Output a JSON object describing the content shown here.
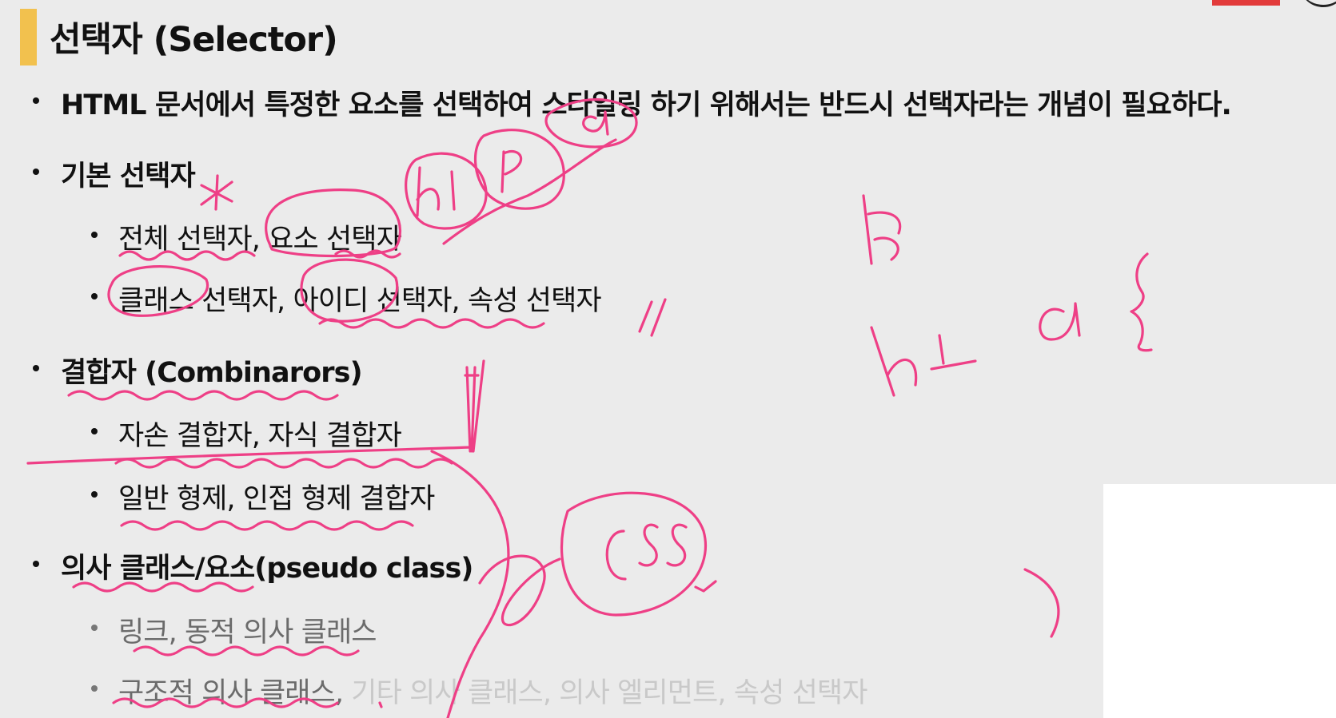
{
  "slide": {
    "title": "선택자 (Selector)",
    "bullets": [
      {
        "text": "HTML 문서에서 특정한 요소를 선택하여 스타일링 하기 위해서는 반드시 선택자라는 개념이 필요하다."
      },
      {
        "text": "기본 선택자",
        "sub": [
          "전체 선택자, 요소 선택자",
          "클래스 선택자, 아이디 선택자, 속성 선택자"
        ]
      },
      {
        "text": "결합자 (Combinarors)",
        "sub": [
          "자손 결합자, 자식 결합자",
          "일반 형제, 인접 형제 결합자"
        ]
      },
      {
        "text": "의사 클래스/요소(pseudo class)",
        "sub": [
          "링크, 동적 의사 클래스"
        ]
      }
    ],
    "last_item": {
      "visible": "구조적 의사 클래스,",
      "faded": " 기타 의사 클래스, 의사 엘리먼트, 속성 선택자"
    }
  },
  "colors": {
    "accent_bar": "#f2c14e",
    "ink": "#ee3f86",
    "background": "#ebebeb"
  }
}
